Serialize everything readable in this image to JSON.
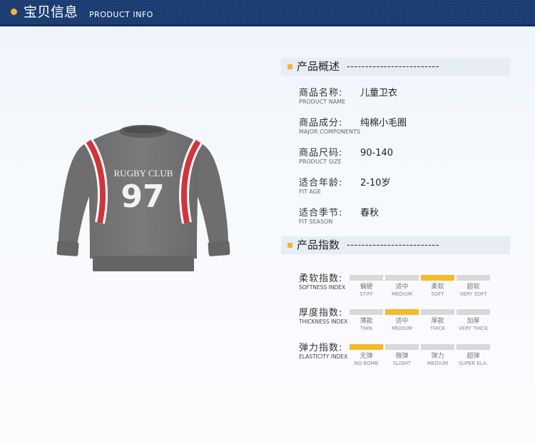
{
  "header": {
    "title_cn": "宝贝信息",
    "title_en": "PRODUCT INFO"
  },
  "colors": {
    "header_bg": "#14376d",
    "accent": "#f7b928",
    "bar_off": "#d9d9d9"
  },
  "product_image": {
    "print_text": "RUGBY CLUB",
    "print_number": "97"
  },
  "overview": {
    "title": "产品概述",
    "dashes": "-------------------------",
    "rows": [
      {
        "label_cn": "商品名称:",
        "label_en": "PRODUCT NAME",
        "value": "儿童卫衣"
      },
      {
        "label_cn": "商品成分:",
        "label_en": "MAJOR COMPONENTS",
        "value": "纯棉小毛圈"
      },
      {
        "label_cn": "商品尺码:",
        "label_en": "PRODUCT SIZE",
        "value": "90-140"
      },
      {
        "label_cn": "适合年龄:",
        "label_en": "FIT AGE",
        "value": "2-10岁"
      },
      {
        "label_cn": "适合季节:",
        "label_en": "FIT SEASON",
        "value": "春秋"
      }
    ]
  },
  "indices": {
    "title": "产品指数",
    "dashes": "-------------------------",
    "items": [
      {
        "label_cn": "柔软指数:",
        "label_en": "SOFTNESS INDEX",
        "selected": 2,
        "levels": [
          {
            "cn": "偏硬",
            "en": "STIFF"
          },
          {
            "cn": "适中",
            "en": "MEDIUM"
          },
          {
            "cn": "柔软",
            "en": "SOFT"
          },
          {
            "cn": "超软",
            "en": "VERY SOFT"
          }
        ]
      },
      {
        "label_cn": "厚度指数:",
        "label_en": "THICKNESS INDEX",
        "selected": 1,
        "levels": [
          {
            "cn": "薄款",
            "en": "THIN"
          },
          {
            "cn": "适中",
            "en": "MEDIUM"
          },
          {
            "cn": "厚款",
            "en": "THICK"
          },
          {
            "cn": "加厚",
            "en": "VERY THICK"
          }
        ]
      },
      {
        "label_cn": "弹力指数:",
        "label_en": "ELASTICITY INDEX",
        "selected": 0,
        "levels": [
          {
            "cn": "无弹",
            "en": "NO BOMB"
          },
          {
            "cn": "微弹",
            "en": "SLIGHT"
          },
          {
            "cn": "弹力",
            "en": "MEDIUM"
          },
          {
            "cn": "超弹",
            "en": "SUPER ELA."
          }
        ]
      }
    ]
  }
}
